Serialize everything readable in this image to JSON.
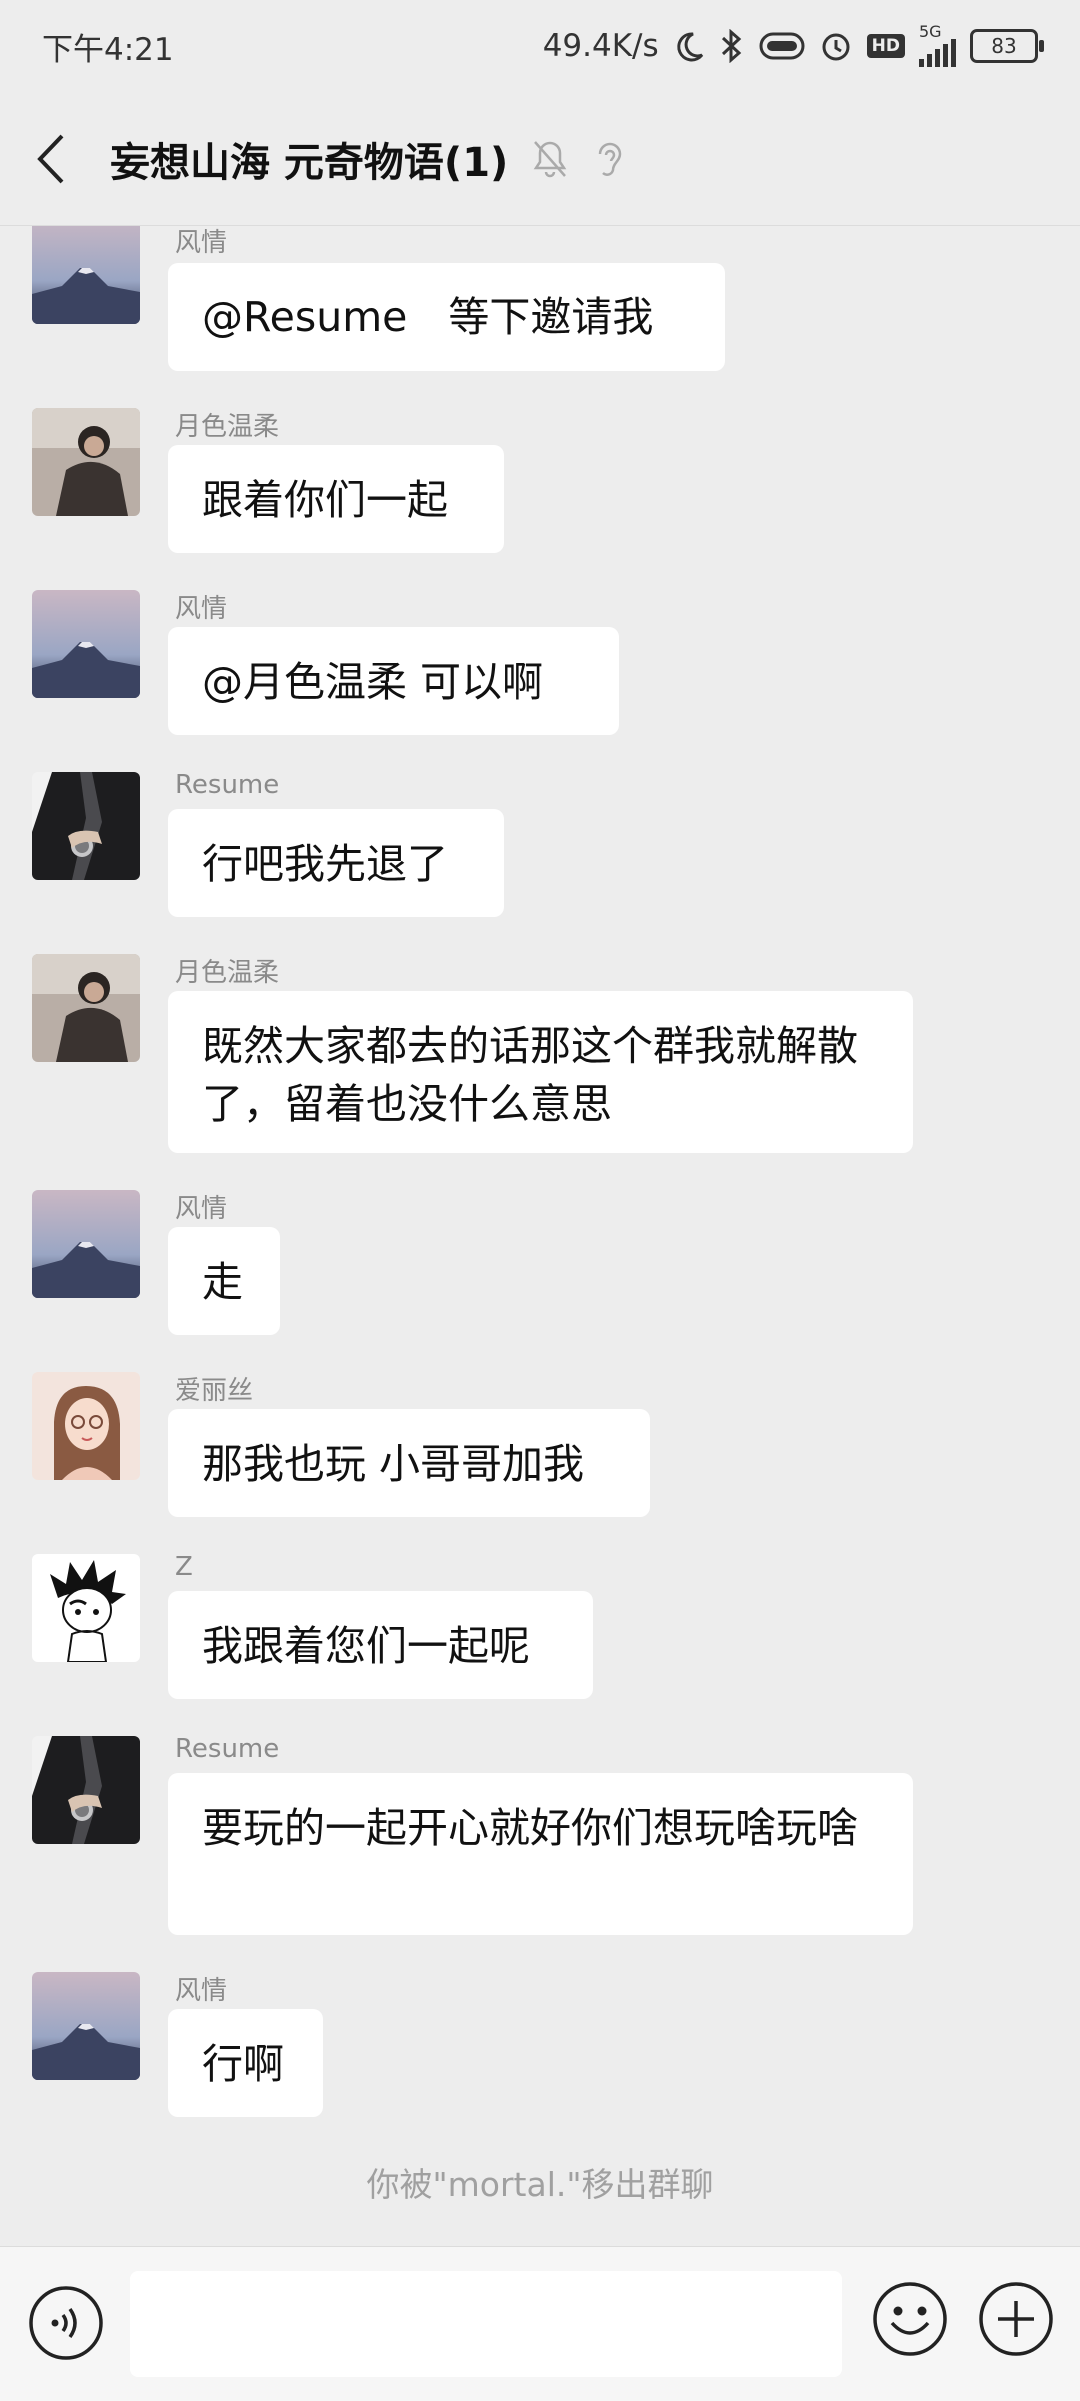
{
  "status_bar": {
    "time": "下午4:21",
    "net_speed": "49.4K/s",
    "network": "5G",
    "battery": "83",
    "hd": "HD"
  },
  "header": {
    "title": "妄想山海 元奇物语(1)"
  },
  "messages": [
    {
      "sender": "风情",
      "text": "@Resume　等下邀请我",
      "avatar": "mountain"
    },
    {
      "sender": "月色温柔",
      "text": "跟着你们一起",
      "avatar": "girl-dark"
    },
    {
      "sender": "风情",
      "text": "@月色温柔 可以啊",
      "avatar": "mountain"
    },
    {
      "sender": "Resume",
      "text": "行吧我先退了",
      "avatar": "suit"
    },
    {
      "sender": "月色温柔",
      "text": "既然大家都去的话那这个群我就解散了，留着也没什么意思",
      "avatar": "girl-dark"
    },
    {
      "sender": "风情",
      "text": "走",
      "avatar": "mountain"
    },
    {
      "sender": "爱丽丝",
      "text": "那我也玩 小哥哥加我",
      "avatar": "anime-girl"
    },
    {
      "sender": "Z",
      "text": "我跟着您们一起呢",
      "avatar": "sketch-boy"
    },
    {
      "sender": "Resume",
      "text": "要玩的一起开心就好你们想玩啥玩啥",
      "avatar": "suit"
    },
    {
      "sender": "风情",
      "text": "行啊",
      "avatar": "mountain"
    }
  ],
  "system_notice": "你被\"mortal.\"移出群聊",
  "input_bar": {
    "placeholder": ""
  },
  "colors": {
    "background": "#ededed",
    "bubble": "#ffffff",
    "sender": "#8a8a8a"
  }
}
